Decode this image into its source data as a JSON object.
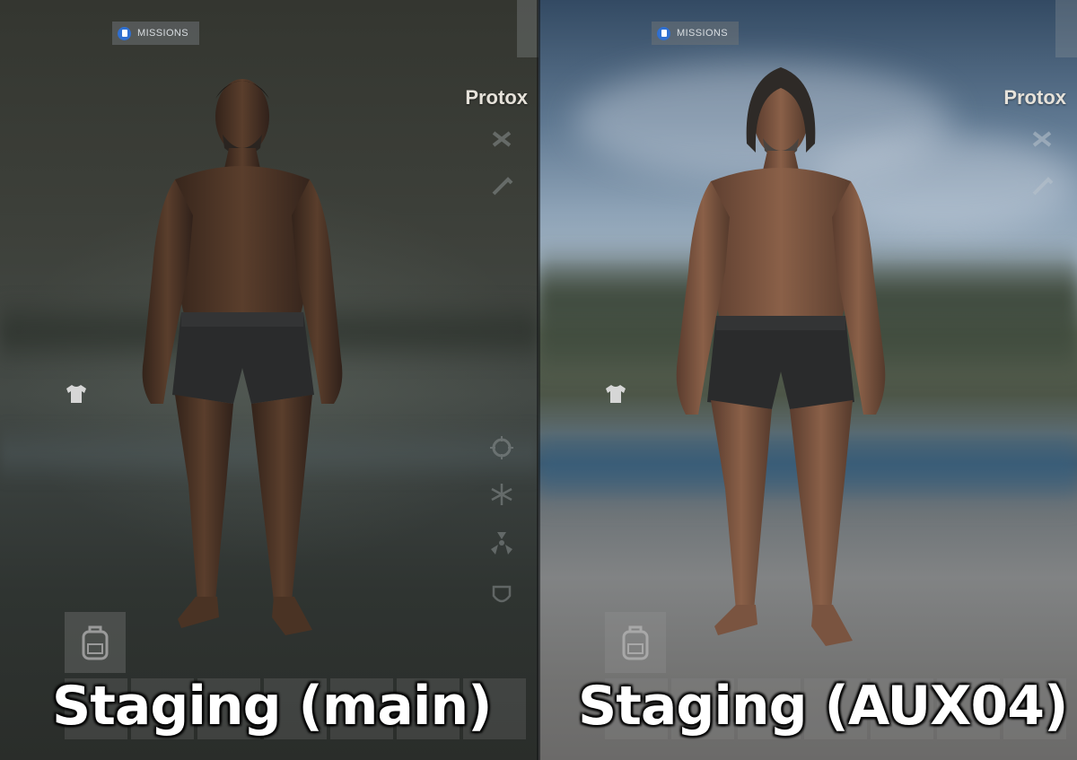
{
  "left_panel": {
    "missions_label": "MISSIONS",
    "player_name": "Protox",
    "caption": "Staging (main)",
    "skin_tone": "#4a3324",
    "hair_color": "#1b1714"
  },
  "right_panel": {
    "missions_label": "MISSIONS",
    "player_name": "Protox",
    "caption": "Staging (AUX04)",
    "skin_tone": "#7a5440",
    "hair_color": "#2e2a27"
  },
  "icons": {
    "missions": "missions-icon",
    "clothing": "shirt-icon",
    "backpack": "backpack-icon",
    "side_status": [
      "crossbones-icon",
      "wrench-icon",
      "food-icon",
      "cold-icon",
      "radiation-icon",
      "shield-icon"
    ]
  },
  "colors": {
    "missions_accent": "#2f6fd0",
    "name_text": "#e6e2da",
    "caption_text": "#ffffff"
  }
}
